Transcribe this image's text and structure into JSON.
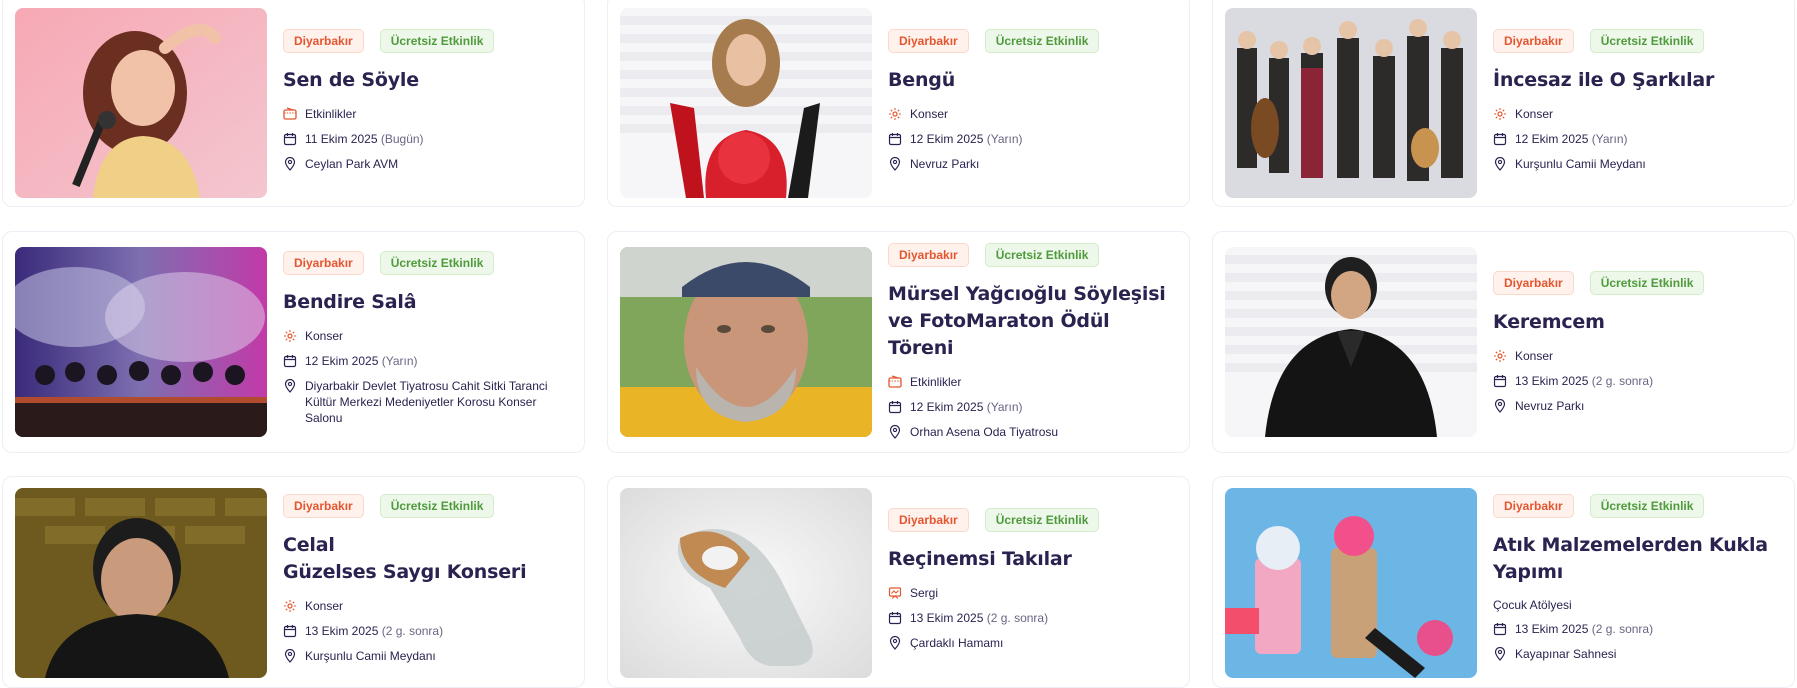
{
  "colors": {
    "city_tag": "#e4562f",
    "free_tag": "#4f9a3c",
    "title": "#2b2250",
    "icon_accent": "#e4562f"
  },
  "events": [
    {
      "city": "Diyarbakır",
      "free": "Ücretsiz Etkinlik",
      "title": [
        "Sen de Söyle"
      ],
      "category": "Etkinlikler",
      "category_icon": "ticket-icon",
      "date": "11 Ekim 2025",
      "relative": "(Bugün)",
      "venue": "Ceylan Park AVM",
      "image": "singer-woman-microphone"
    },
    {
      "city": "Diyarbakır",
      "free": "Ücretsiz Etkinlik",
      "title": [
        "Bengü"
      ],
      "category": "Konser",
      "category_icon": "concert-icon",
      "date": "12 Ekim 2025",
      "relative": "(Yarın)",
      "venue": "Nevruz Parkı",
      "image": "singer-red-dress"
    },
    {
      "city": "Diyarbakır",
      "free": "Ücretsiz Etkinlik",
      "title": [
        "İncesaz ile O Şarkılar"
      ],
      "category": "Konser",
      "category_icon": "concert-icon",
      "date": "12 Ekim 2025",
      "relative": "(Yarın)",
      "venue": "Kurşunlu Camii Meydanı",
      "image": "band-group-photo"
    },
    {
      "city": "Diyarbakır",
      "free": "Ücretsiz Etkinlik",
      "title": [
        "Bendire Salâ"
      ],
      "category": "Konser",
      "category_icon": "concert-icon",
      "date": "12 Ekim 2025",
      "relative": "(Yarın)",
      "venue": "Diyarbakir Devlet Tiyatrosu Cahit Sitki Taranci Kültür Merkezi Medeniyetler Korosu Konser Salonu",
      "image": "stage-drummers"
    },
    {
      "city": "Diyarbakır",
      "free": "Ücretsiz Etkinlik",
      "title": [
        "Mürsel Yağcıoğlu Söyleşisi",
        "ve FotoMaraton Ödül",
        "Töreni"
      ],
      "category": "Etkinlikler",
      "category_icon": "ticket-icon",
      "date": "12 Ekim 2025",
      "relative": "(Yarın)",
      "venue": "Orhan Asena Oda Tiyatrosu",
      "image": "man-selfie-cap"
    },
    {
      "city": "Diyarbakır",
      "free": "Ücretsiz Etkinlik",
      "title": [
        "Keremcem"
      ],
      "category": "Konser",
      "category_icon": "concert-icon",
      "date": "13 Ekim 2025",
      "relative": "(2 g. sonra)",
      "venue": "Nevruz Parkı",
      "image": "singer-black-suit"
    },
    {
      "city": "Diyarbakır",
      "free": "Ücretsiz Etkinlik",
      "title": [
        "Celal",
        "Güzelses Saygı Konseri"
      ],
      "category": "Konser",
      "category_icon": "concert-icon",
      "date": "13 Ekim 2025",
      "relative": "(2 g. sonra)",
      "venue": "Kurşunlu Camii Meydanı",
      "image": "singer-portrait-brick"
    },
    {
      "city": "Diyarbakır",
      "free": "Ücretsiz Etkinlik",
      "title": [
        "Reçinemsi Takılar"
      ],
      "category": "Sergi",
      "category_icon": "exhibition-icon",
      "date": "13 Ekim 2025",
      "relative": "(2 g. sonra)",
      "venue": "Çardaklı Hamamı",
      "image": "resin-wood-ring"
    },
    {
      "city": "Diyarbakır",
      "free": "Ücretsiz Etkinlik",
      "title": [
        "Atık Malzemelerden Kukla",
        "Yapımı"
      ],
      "category": "Çocuk Atölyesi",
      "category_icon": "",
      "date": "13 Ekim 2025",
      "relative": "(2 g. sonra)",
      "venue": "Kayapınar Sahnesi",
      "image": "paper-roll-puppets"
    }
  ]
}
